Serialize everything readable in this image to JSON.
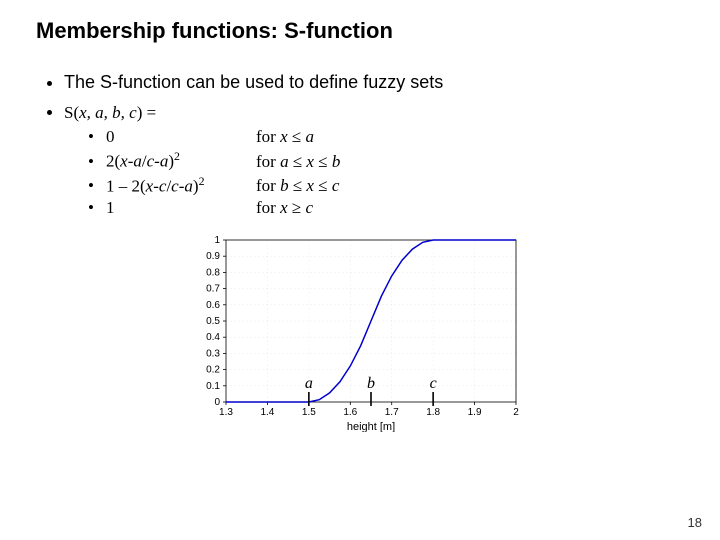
{
  "title": "Membership functions: S-function",
  "intro": "The S-function can be used to define fuzzy sets",
  "func_def_prefix": "S(",
  "func_def_vars": "x, a, b, c",
  "func_def_suffix": ") =",
  "pieces": [
    {
      "expr_html": "0",
      "cond_html": "for <span class='ital'>x</span> ≤ <span class='ital'>a</span>"
    },
    {
      "expr_html": "2(<span class='ital'>x</span>-<span class='ital'>a</span>/<span class='ital'>c</span>-<span class='ital'>a</span>)<sup>2</sup>",
      "cond_html": "for <span class='ital'>a</span> ≤ <span class='ital'>x</span> ≤ <span class='ital'>b</span>"
    },
    {
      "expr_html": "1 – 2(<span class='ital'>x</span>-<span class='ital'>c</span>/<span class='ital'>c</span>-<span class='ital'>a</span>)<sup>2</sup>",
      "cond_html": "for <span class='ital'>b</span> ≤ <span class='ital'>x</span> ≤ <span class='ital'>c</span>"
    },
    {
      "expr_html": "1",
      "cond_html": "for <span class='ital'>x</span> ≥ <span class='ital'>c</span>"
    }
  ],
  "page_number": "18",
  "chart_data": {
    "type": "line",
    "title": "",
    "xlabel": "height [m]",
    "ylabel": "",
    "xlim": [
      1.3,
      2.0
    ],
    "ylim": [
      0,
      1
    ],
    "xticks": [
      1.3,
      1.4,
      1.5,
      1.6,
      1.7,
      1.8,
      1.9,
      2
    ],
    "yticks": [
      0,
      0.1,
      0.2,
      0.3,
      0.4,
      0.5,
      0.6,
      0.7,
      0.8,
      0.9,
      1
    ],
    "params": {
      "a": 1.5,
      "b": 1.65,
      "c": 1.8
    },
    "annotations": [
      {
        "label": "a",
        "x": 1.5
      },
      {
        "label": "b",
        "x": 1.65
      },
      {
        "label": "c",
        "x": 1.8
      }
    ],
    "series": [
      {
        "name": "S-function",
        "x": [
          1.3,
          1.35,
          1.4,
          1.45,
          1.5,
          1.525,
          1.55,
          1.575,
          1.6,
          1.625,
          1.65,
          1.675,
          1.7,
          1.725,
          1.75,
          1.775,
          1.8,
          1.85,
          1.9,
          1.95,
          2.0
        ],
        "y": [
          0.0,
          0.0,
          0.0,
          0.0,
          0.0,
          0.014,
          0.056,
          0.125,
          0.222,
          0.347,
          0.5,
          0.653,
          0.778,
          0.875,
          0.944,
          0.986,
          1.0,
          1.0,
          1.0,
          1.0,
          1.0
        ]
      }
    ]
  }
}
